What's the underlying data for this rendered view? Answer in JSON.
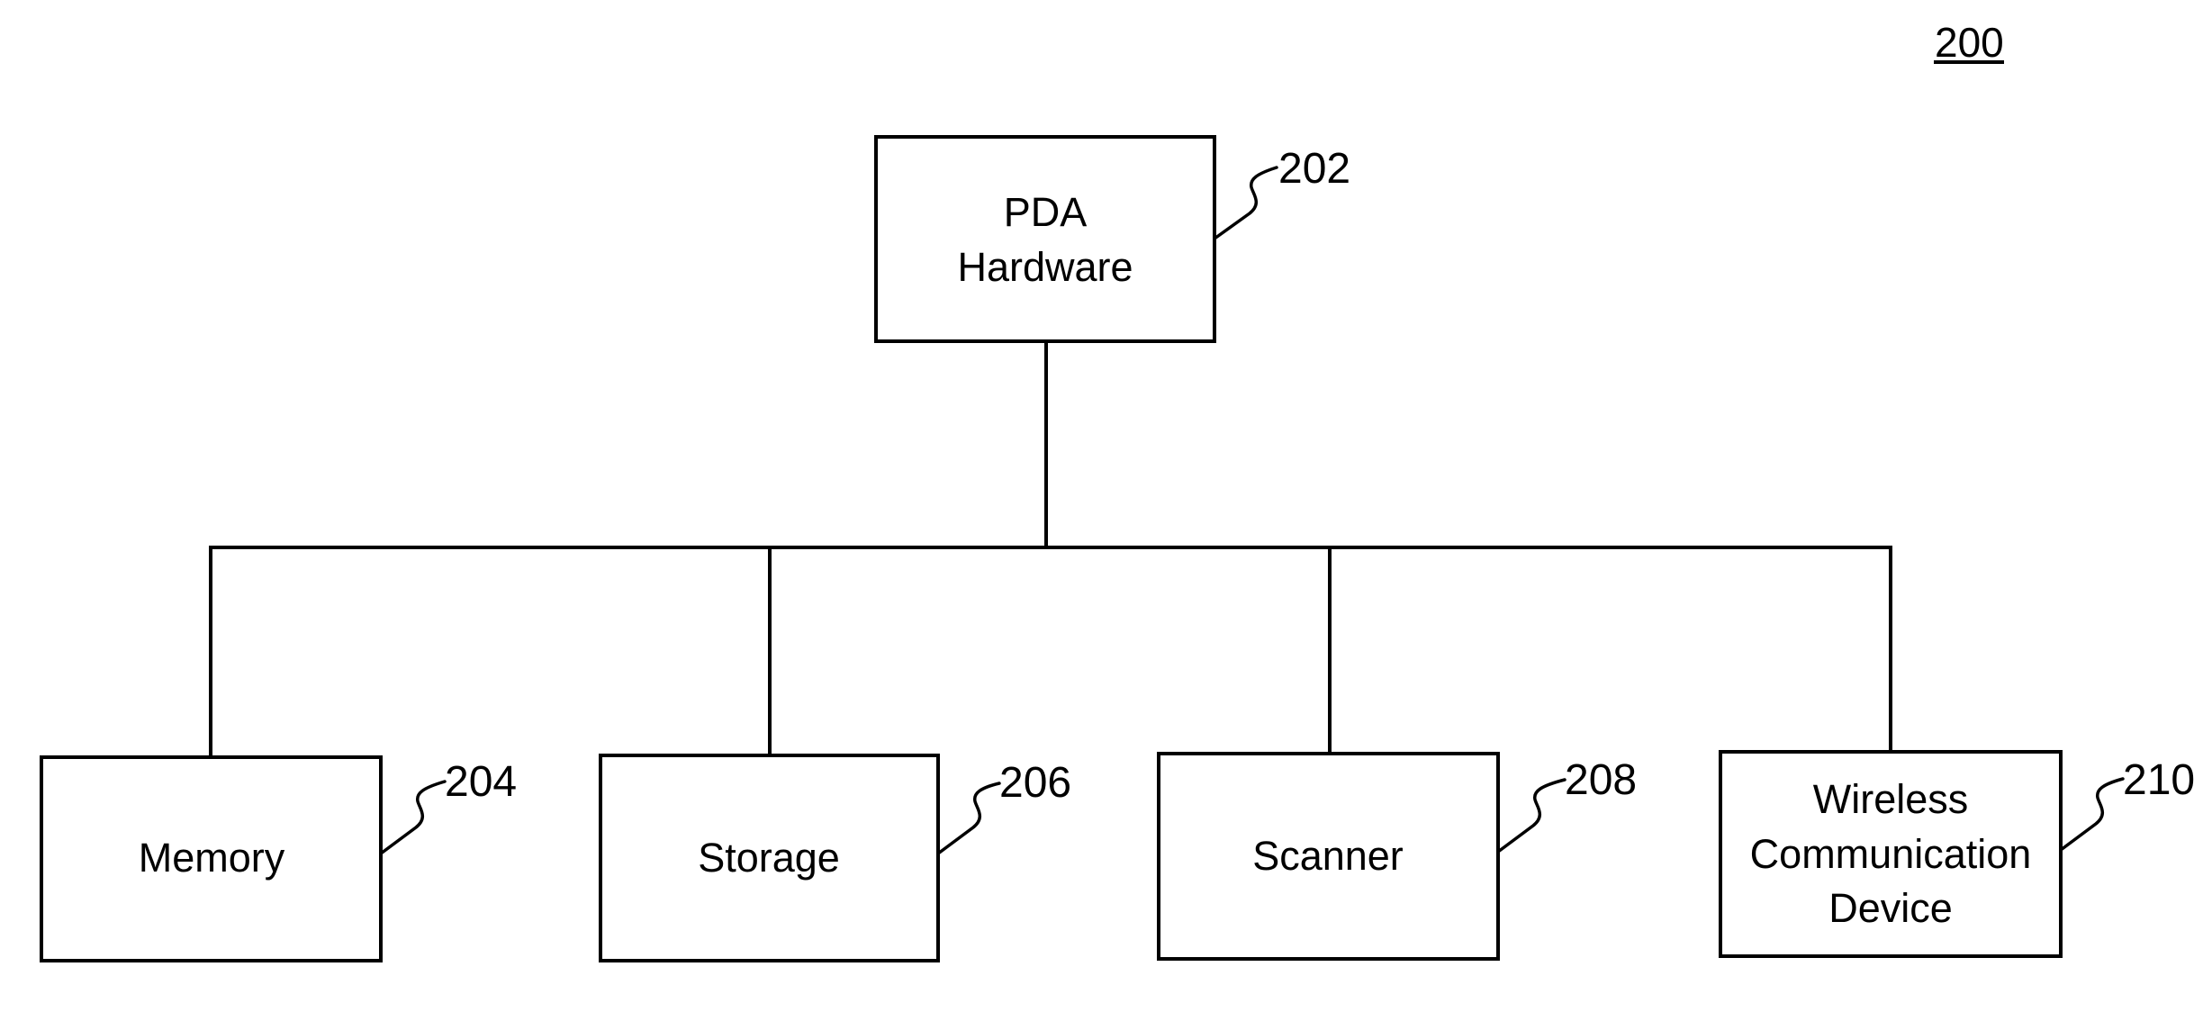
{
  "figure": {
    "number": "200"
  },
  "colors": {
    "line": "#000000",
    "background": "#ffffff"
  },
  "nodes": [
    {
      "id": "pda_hardware",
      "ref": "202",
      "lines": [
        "PDA",
        "Hardware"
      ]
    },
    {
      "id": "memory",
      "ref": "204",
      "lines": [
        "Memory"
      ]
    },
    {
      "id": "storage",
      "ref": "206",
      "lines": [
        "Storage"
      ]
    },
    {
      "id": "scanner",
      "ref": "208",
      "lines": [
        "Scanner"
      ]
    },
    {
      "id": "wireless_communication_device",
      "ref": "210",
      "lines": [
        "Wireless",
        "Communication",
        "Device"
      ]
    }
  ],
  "edges": [
    {
      "from": "pda_hardware",
      "to": "memory"
    },
    {
      "from": "pda_hardware",
      "to": "storage"
    },
    {
      "from": "pda_hardware",
      "to": "scanner"
    },
    {
      "from": "pda_hardware",
      "to": "wireless_communication_device"
    }
  ]
}
